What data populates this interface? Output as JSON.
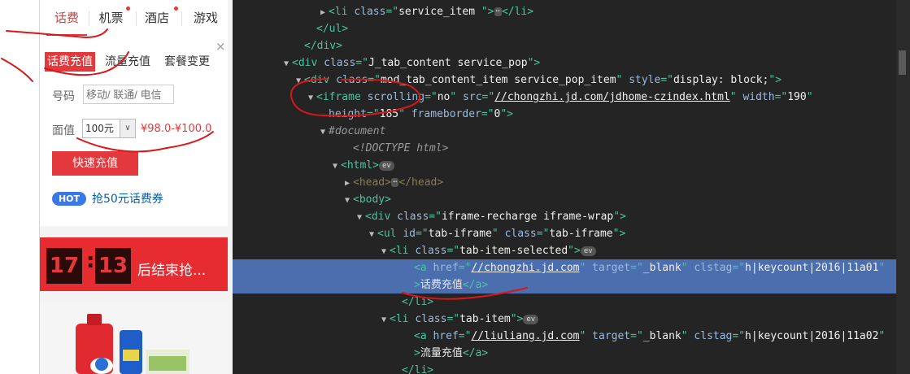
{
  "page": {
    "main_tabs": [
      "话费",
      "机票",
      "酒店",
      "游戏"
    ],
    "sub_tabs": [
      "话费充值",
      "流量充值",
      "套餐变更"
    ],
    "phone_label": "号码",
    "phone_placeholder": "移动/ 联通/ 电信",
    "amount_label": "面值",
    "amount_value": "100元",
    "price_text": "¥98.0-¥100.0",
    "recharge_button": "快速充值",
    "hot_badge": "HOT",
    "coupon_text": "抢50元话费券",
    "close_symbol": "×",
    "seckill": {
      "hours": "17",
      "minutes": "13",
      "text": "后结束抢..."
    },
    "toolbar_icons": [
      "user-icon",
      "cart-icon",
      "heart-icon",
      "history-icon",
      "chat-icon"
    ],
    "accent_color": "#e4393c"
  },
  "devtools": {
    "lines": [
      {
        "indent": 6,
        "tri": "▶",
        "parts": [
          [
            "tag",
            "<li "
          ],
          [
            "attr",
            "class"
          ],
          [
            "tag",
            "=\""
          ],
          [
            "val",
            "service_item "
          ],
          [
            "tag",
            "\">"
          ],
          [
            "ellipsis",
            "⋯"
          ],
          [
            "tag",
            "</li>"
          ]
        ]
      },
      {
        "indent": 5,
        "tri": "",
        "parts": [
          [
            "tag",
            "</ul>"
          ]
        ]
      },
      {
        "indent": 4,
        "tri": "",
        "parts": [
          [
            "tag",
            "</div>"
          ]
        ]
      },
      {
        "indent": 3,
        "tri": "▼",
        "parts": [
          [
            "tag",
            "<div "
          ],
          [
            "attr",
            "class"
          ],
          [
            "tag",
            "=\""
          ],
          [
            "val",
            "J_tab_content service_pop"
          ],
          [
            "tag",
            "\">"
          ]
        ]
      },
      {
        "indent": 4,
        "tri": "▼",
        "parts": [
          [
            "tag",
            "<div "
          ],
          [
            "attr",
            "class"
          ],
          [
            "tag",
            "=\""
          ],
          [
            "val",
            "mod_tab_content_item service_pop_item"
          ],
          [
            "tag",
            "\" "
          ],
          [
            "attr",
            "style"
          ],
          [
            "tag",
            "=\""
          ],
          [
            "val",
            "display: block;"
          ],
          [
            "tag",
            "\">"
          ]
        ]
      },
      {
        "indent": 5,
        "tri": "▼",
        "parts": [
          [
            "tag",
            "<iframe "
          ],
          [
            "attr",
            "scrolling"
          ],
          [
            "tag",
            "=\""
          ],
          [
            "val",
            "no"
          ],
          [
            "tag",
            "\" "
          ],
          [
            "attr",
            "src"
          ],
          [
            "tag",
            "=\""
          ],
          [
            "url",
            "//chongzhi.jd.com/jdhome-czindex.html"
          ],
          [
            "tag",
            "\" "
          ],
          [
            "attr",
            "width"
          ],
          [
            "tag",
            "=\""
          ],
          [
            "val",
            "190"
          ],
          [
            "tag",
            "\""
          ]
        ]
      },
      {
        "indent": 6,
        "tri": "",
        "parts": [
          [
            "attr",
            "height"
          ],
          [
            "tag",
            "=\""
          ],
          [
            "val",
            "185"
          ],
          [
            "tag",
            "\" "
          ],
          [
            "attr",
            "frameborder"
          ],
          [
            "tag",
            "=\""
          ],
          [
            "val",
            "0"
          ],
          [
            "tag",
            "\">"
          ]
        ]
      },
      {
        "indent": 6,
        "tri": "▼",
        "parts": [
          [
            "comment",
            "#document"
          ]
        ]
      },
      {
        "indent": 8,
        "tri": "",
        "parts": [
          [
            "comment",
            "<!DOCTYPE html>"
          ]
        ]
      },
      {
        "indent": 7,
        "tri": "▼",
        "parts": [
          [
            "tag",
            "<html>"
          ],
          [
            "ev",
            "ev"
          ]
        ]
      },
      {
        "indent": 8,
        "tri": "▶",
        "parts": [
          [
            "dim",
            "<head>"
          ],
          [
            "ellipsis",
            "⋯"
          ],
          [
            "dim",
            "</head>"
          ]
        ]
      },
      {
        "indent": 8,
        "tri": "▼",
        "parts": [
          [
            "tag",
            "<body>"
          ]
        ]
      },
      {
        "indent": 9,
        "tri": "▼",
        "parts": [
          [
            "tag",
            "<div "
          ],
          [
            "attr",
            "class"
          ],
          [
            "tag",
            "=\""
          ],
          [
            "val",
            "iframe-recharge iframe-wrap"
          ],
          [
            "tag",
            "\">"
          ]
        ]
      },
      {
        "indent": 10,
        "tri": "▼",
        "parts": [
          [
            "tag",
            "<ul "
          ],
          [
            "attr",
            "id"
          ],
          [
            "tag",
            "=\""
          ],
          [
            "val",
            "tab-iframe"
          ],
          [
            "tag",
            "\" "
          ],
          [
            "attr",
            "class"
          ],
          [
            "tag",
            "=\""
          ],
          [
            "val",
            "tab-iframe"
          ],
          [
            "tag",
            "\">"
          ]
        ]
      },
      {
        "indent": 11,
        "tri": "▼",
        "parts": [
          [
            "tag",
            "<li "
          ],
          [
            "attr",
            "class"
          ],
          [
            "tag",
            "=\""
          ],
          [
            "val",
            "tab-item-selected"
          ],
          [
            "tag",
            "\">"
          ],
          [
            "ev",
            "ev"
          ]
        ]
      },
      {
        "indent": 13,
        "tri": "",
        "selected": true,
        "parts": [
          [
            "tag",
            "<a "
          ],
          [
            "attr",
            "href"
          ],
          [
            "tag",
            "=\""
          ],
          [
            "url",
            "//chongzhi.jd.com"
          ],
          [
            "tag",
            "\" "
          ],
          [
            "attr",
            "target"
          ],
          [
            "tag",
            "=\""
          ],
          [
            "val",
            "_blank"
          ],
          [
            "tag",
            "\" "
          ],
          [
            "attr",
            "clstag"
          ],
          [
            "tag",
            "=\""
          ],
          [
            "val",
            "h|keycount|2016|11a01"
          ],
          [
            "tag",
            "\""
          ]
        ]
      },
      {
        "indent": 13,
        "tri": "",
        "selected": true,
        "parts": [
          [
            "tag",
            ">"
          ],
          [
            "txt",
            "话费充值"
          ],
          [
            "tag",
            "</a>"
          ]
        ]
      },
      {
        "indent": 12,
        "tri": "",
        "parts": [
          [
            "tag",
            "</li>"
          ]
        ]
      },
      {
        "indent": 11,
        "tri": "▼",
        "parts": [
          [
            "tag",
            "<li "
          ],
          [
            "attr",
            "class"
          ],
          [
            "tag",
            "=\""
          ],
          [
            "val",
            "tab-item"
          ],
          [
            "tag",
            "\">"
          ],
          [
            "ev",
            "ev"
          ]
        ]
      },
      {
        "indent": 13,
        "tri": "",
        "parts": [
          [
            "tag",
            "<a "
          ],
          [
            "attr",
            "href"
          ],
          [
            "tag",
            "=\""
          ],
          [
            "url",
            "//liuliang.jd.com"
          ],
          [
            "tag",
            "\" "
          ],
          [
            "attr",
            "target"
          ],
          [
            "tag",
            "=\""
          ],
          [
            "val",
            "_blank"
          ],
          [
            "tag",
            "\" "
          ],
          [
            "attr",
            "clstag"
          ],
          [
            "tag",
            "=\""
          ],
          [
            "val",
            "h|keycount|2016|11a02"
          ],
          [
            "tag",
            "\""
          ]
        ]
      },
      {
        "indent": 13,
        "tri": "",
        "parts": [
          [
            "tag",
            ">"
          ],
          [
            "txt",
            "流量充值"
          ],
          [
            "tag",
            "</a>"
          ]
        ]
      },
      {
        "indent": 12,
        "tri": "",
        "parts": [
          [
            "tag",
            "</li>"
          ]
        ]
      }
    ]
  }
}
